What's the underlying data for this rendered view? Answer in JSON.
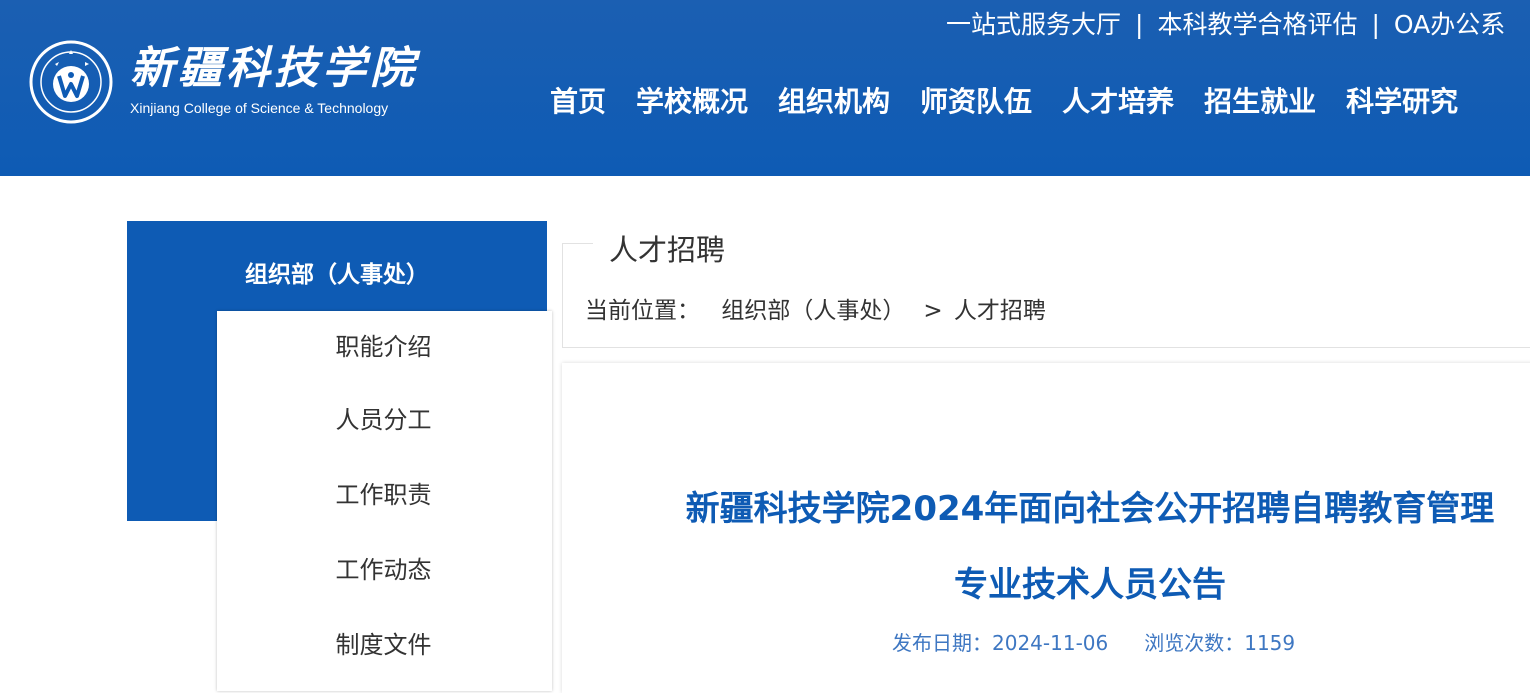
{
  "header": {
    "top_links": [
      "一站式服务大厅",
      "本科教学合格评估",
      "OA办公系"
    ],
    "top_separator": "|",
    "logo": {
      "name_cn": "新疆科技学院",
      "name_en": "Xinjiang College of Science & Technology",
      "emblem_text": "Xinjiang College of Science & Technology"
    },
    "nav": [
      "首页",
      "学校概况",
      "组织机构",
      "师资队伍",
      "人才培养",
      "招生就业",
      "科学研究"
    ]
  },
  "sidebar": {
    "title": "组织部（人事处）",
    "items": [
      "职能介绍",
      "人员分工",
      "工作职责",
      "工作动态",
      "制度文件"
    ]
  },
  "section": {
    "title": "人才招聘",
    "breadcrumb_label": "当前位置：",
    "breadcrumb": [
      "组织部（人事处）",
      "人才招聘"
    ],
    "breadcrumb_sep": ">"
  },
  "article": {
    "title": "新疆科技学院2024年面向社会公开招聘自聘教育管理专业技术人员公告",
    "date_label": "发布日期：",
    "date": "2024-11-06",
    "views_label": "浏览次数：",
    "views": "1159"
  },
  "colors": {
    "brand_blue": "#0e5bb4",
    "meta_blue": "#3e77c2",
    "text": "#333333"
  }
}
